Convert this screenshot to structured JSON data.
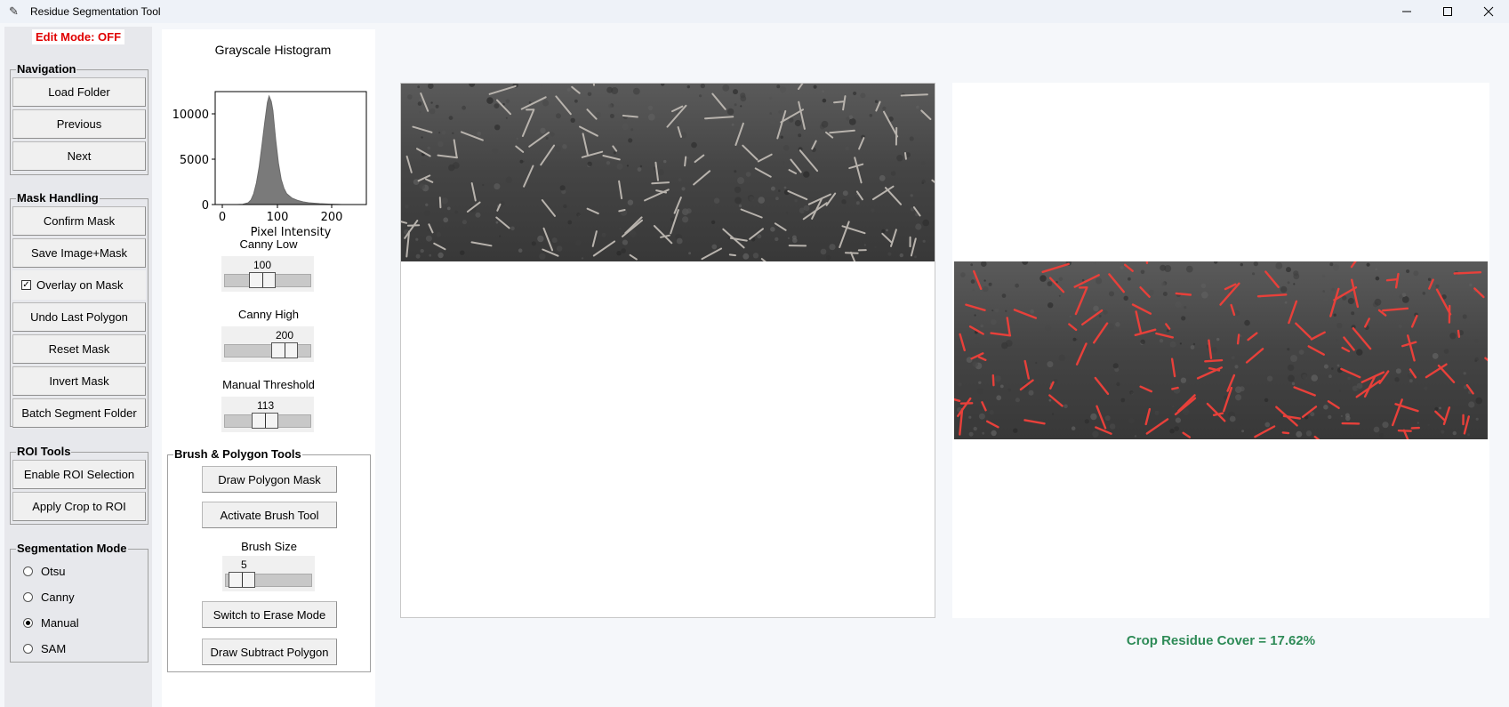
{
  "window": {
    "title": "Residue Segmentation Tool"
  },
  "edit_mode": "Edit Mode: OFF",
  "navigation": {
    "title": "Navigation",
    "load_folder": "Load Folder",
    "previous": "Previous",
    "next": "Next"
  },
  "mask_handling": {
    "title": "Mask Handling",
    "confirm_mask": "Confirm Mask",
    "save_image_mask": "Save Image+Mask",
    "overlay_on_mask": "Overlay on Mask",
    "overlay_checked": true,
    "undo_last_polygon": "Undo Last Polygon",
    "reset_mask": "Reset Mask",
    "invert_mask": "Invert Mask",
    "batch_segment_folder": "Batch Segment Folder"
  },
  "roi_tools": {
    "title": "ROI Tools",
    "enable_roi_selection": "Enable ROI Selection",
    "apply_crop_to_roi": "Apply Crop to ROI"
  },
  "segmentation_mode": {
    "title": "Segmentation Mode",
    "options": [
      "Otsu",
      "Canny",
      "Manual",
      "SAM"
    ],
    "selected": "Manual"
  },
  "histogram": {
    "title": "Grayscale Histogram",
    "xlabel": "Pixel Intensity",
    "y_ticks": [
      "10000",
      "5000",
      "0"
    ],
    "x_ticks": [
      "0",
      "100",
      "200"
    ]
  },
  "chart_data": {
    "type": "area",
    "title": "Grayscale Histogram",
    "xlabel": "Pixel Intensity",
    "ylabel": "",
    "xlim": [
      -10,
      265
    ],
    "ylim": [
      0,
      12500
    ],
    "x": [
      30,
      40,
      50,
      55,
      60,
      65,
      70,
      75,
      80,
      85,
      88,
      90,
      92,
      95,
      100,
      105,
      110,
      115,
      120,
      130,
      140,
      150,
      160,
      170,
      180,
      200,
      220
    ],
    "values": [
      0,
      30,
      200,
      500,
      1200,
      2400,
      4200,
      6500,
      9000,
      11300,
      12000,
      11700,
      11400,
      10400,
      7200,
      4600,
      2800,
      1800,
      1200,
      700,
      450,
      300,
      200,
      150,
      100,
      40,
      0
    ],
    "grid": false
  },
  "sliders": {
    "canny_low": {
      "label": "Canny Low",
      "value": "100",
      "fraction": 0.4
    },
    "canny_high": {
      "label": "Canny High",
      "value": "200",
      "fraction": 0.79
    },
    "manual_threshold": {
      "label": "Manual Threshold",
      "value": "113",
      "fraction": 0.44
    },
    "brush_size": {
      "label": "Brush Size",
      "value": "5",
      "fraction": 0.1
    }
  },
  "brush_tools": {
    "title": "Brush & Polygon Tools",
    "draw_polygon_mask": "Draw Polygon Mask",
    "activate_brush_tool": "Activate Brush Tool",
    "switch_to_erase_mode": "Switch to Erase Mode",
    "draw_subtract_polygon": "Draw Subtract Polygon"
  },
  "result": {
    "crop_residue_cover": "Crop Residue Cover = 17.62%"
  },
  "colors": {
    "edit_mode": "#e00000",
    "result_text": "#2e8b57",
    "overlay": "#e8403a"
  }
}
